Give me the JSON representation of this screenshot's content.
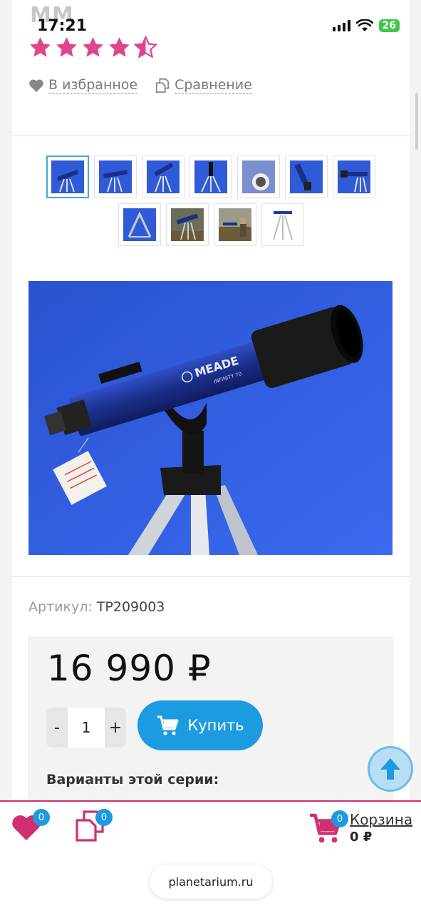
{
  "status": {
    "time": "17:21",
    "battery": "26"
  },
  "product": {
    "brand_partial": "MM",
    "rating": 4.5,
    "favorite_label": "В избранное",
    "compare_label": "Сравнение",
    "sku_label": "Артикул:",
    "sku_value": "TP209003",
    "price": "16 990 ₽",
    "qty": "1",
    "qty_minus": "-",
    "qty_plus": "+",
    "buy_label": "Купить",
    "variants_label": "Варианты этой серии:"
  },
  "image": {
    "brand_text": "MEADE",
    "model_text": "INFINITY 70"
  },
  "thumbnails_row1": [
    "t1",
    "t2",
    "t3",
    "t4",
    "t5",
    "t6",
    "t7"
  ],
  "thumbnails_row2": [
    "t8",
    "t9",
    "t10",
    "t11"
  ],
  "bottom_bar": {
    "favorites_count": "0",
    "compare_count": "0",
    "cart_count": "0",
    "cart_label": "Корзина",
    "cart_sum": "0 ₽"
  },
  "browser": {
    "url": "planetarium.ru"
  },
  "colors": {
    "accent": "#1c9be0",
    "stars": "#e0458c",
    "bottom_border": "#d0306f"
  },
  "icons": [
    "heart-icon",
    "compare-icon",
    "cart-icon",
    "arrow-up-icon",
    "star-icon"
  ]
}
